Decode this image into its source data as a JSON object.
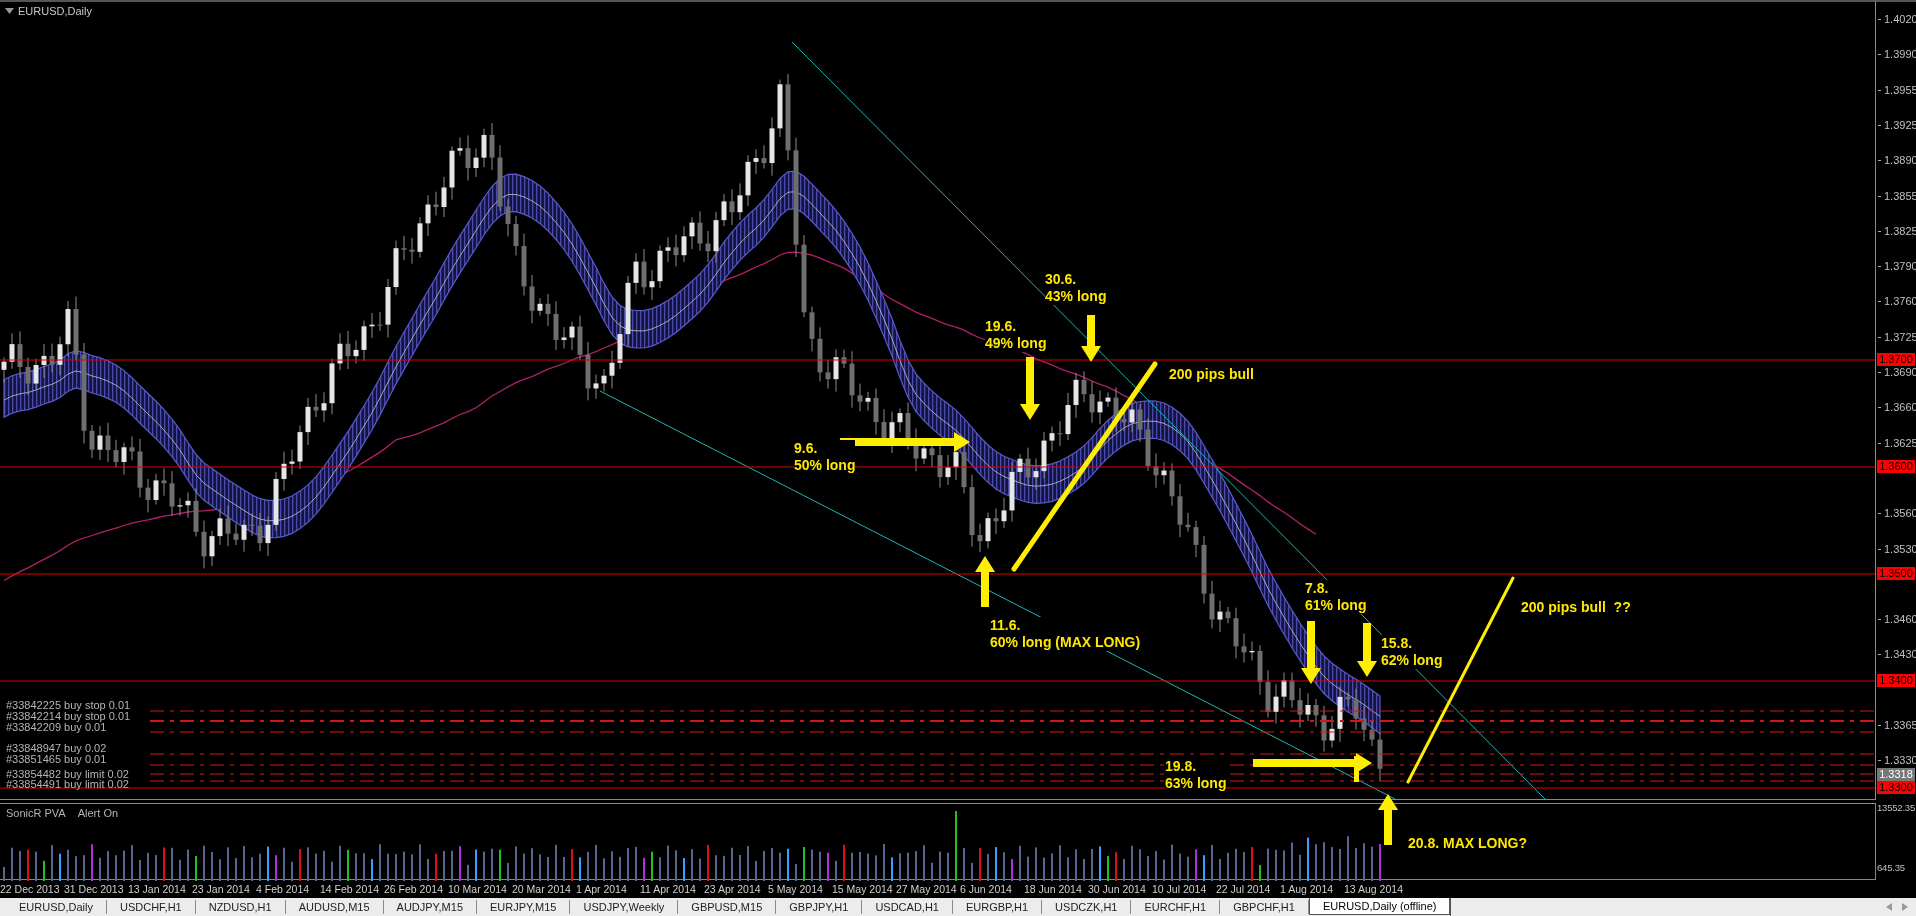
{
  "window": {
    "title": "EURUSD,Daily"
  },
  "annotations": [
    {
      "text": "30.6.\n43% long"
    },
    {
      "text": "19.6.\n49% long"
    },
    {
      "text": "9.6.\n50% long"
    },
    {
      "text": "200 pips bull"
    },
    {
      "text": "11.6.\n60% long (MAX LONG)"
    },
    {
      "text": "7.8.\n61% long"
    },
    {
      "text": "15.8.\n62% long"
    },
    {
      "text": "200 pips bull  ??"
    },
    {
      "text": "19.8.\n63% long"
    },
    {
      "text": "20.8. MAX LONG?"
    }
  ],
  "orders": [
    {
      "label": "#33842225 buy stop 0.01"
    },
    {
      "label": "#33842214 buy stop 0.01"
    },
    {
      "label": "#33842209 buy 0.01"
    },
    {
      "label": "#33848947 buy 0.02"
    },
    {
      "label": "#33851465 buy 0.01"
    },
    {
      "label": "#33854482 buy limit 0.02"
    },
    {
      "label": "#33854491 buy limit 0.02"
    }
  ],
  "price_axis": {
    "ticks": [
      "1.4020",
      "1.3990",
      "1.3955",
      "1.3925",
      "1.3890",
      "1.3855",
      "1.3825",
      "1.3790",
      "1.3760",
      "1.3725",
      "1.3690",
      "1.3660",
      "1.3625",
      "1.3560",
      "1.3530",
      "1.3460",
      "1.3430",
      "1.3365",
      "1.3330"
    ],
    "price_levels": [
      {
        "label": "1.3700"
      },
      {
        "label": "1.3600"
      },
      {
        "label": "1.3500"
      },
      {
        "label": "1.3400"
      },
      {
        "label": "1.3300"
      }
    ],
    "current_price": "1.3318"
  },
  "indicator": {
    "labels": [
      "SonicR PVA",
      "Alert On"
    ],
    "axis": [
      "13552.35",
      "645.35"
    ]
  },
  "date_axis": [
    "22 Dec 2013",
    "31 Dec 2013",
    "13 Jan 2014",
    "23 Jan 2014",
    "4 Feb 2014",
    "14 Feb 2014",
    "26 Feb 2014",
    "10 Mar 2014",
    "20 Mar 2014",
    "1 Apr 2014",
    "11 Apr 2014",
    "23 Apr 2014",
    "5 May 2014",
    "15 May 2014",
    "27 May 2014",
    "6 Jun 2014",
    "18 Jun 2014",
    "30 Jun 2014",
    "10 Jul 2014",
    "22 Jul 2014",
    "1 Aug 2014",
    "13 Aug 2014"
  ],
  "tabs": [
    {
      "label": "EURUSD,Daily",
      "selected": false
    },
    {
      "label": "USDCHF,H1",
      "selected": false
    },
    {
      "label": "NZDUSD,H1",
      "selected": false
    },
    {
      "label": "AUDUSD,M15",
      "selected": false
    },
    {
      "label": "AUDJPY,M15",
      "selected": false
    },
    {
      "label": "EURJPY,M15",
      "selected": false
    },
    {
      "label": "USDJPY,Weekly",
      "selected": false
    },
    {
      "label": "GBPUSD,M15",
      "selected": false
    },
    {
      "label": "GBPJPY,H1",
      "selected": false
    },
    {
      "label": "USDCAD,H1",
      "selected": false
    },
    {
      "label": "EURGBP,H1",
      "selected": false
    },
    {
      "label": "USDCZK,H1",
      "selected": false
    },
    {
      "label": "EURCHF,H1",
      "selected": false
    },
    {
      "label": "GBPCHF,H1",
      "selected": false
    },
    {
      "label": "EURUSD,Daily (offline)",
      "selected": true
    }
  ]
}
